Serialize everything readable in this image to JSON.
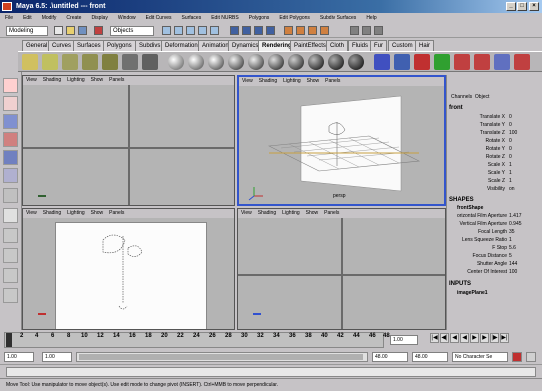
{
  "window": {
    "title": "Maya 6.5: .\\untitled   ---   front",
    "buttons": [
      "_",
      "□",
      "×"
    ]
  },
  "menus": [
    "File",
    "Edit",
    "Modify",
    "Create",
    "Display",
    "Window",
    "Edit Curves",
    "Surfaces",
    "Edit NURBS",
    "Polygons",
    "Edit Polygons",
    "Subdiv Surfaces",
    "Help"
  ],
  "status_line": {
    "mode": "Modeling",
    "selection_mask": "Objects"
  },
  "shelf_tabs": [
    "General",
    "Curves",
    "Surfaces",
    "Polygons",
    "Subdivs",
    "Deformation",
    "Animation",
    "Dynamics",
    "Rendering",
    "PaintEffects",
    "Cloth",
    "Fluids",
    "Fur",
    "Custom",
    "Hair"
  ],
  "active_shelf_tab": "Rendering",
  "viewport_menu": [
    "View",
    "Shading",
    "Lighting",
    "Show",
    "Panels"
  ],
  "viewports": {
    "top_right_label": "persp"
  },
  "channel_box": {
    "tabs": [
      "Channels",
      "Object"
    ],
    "object": "front",
    "transform": [
      {
        "name": "Translate X",
        "value": "0"
      },
      {
        "name": "Translate Y",
        "value": "0"
      },
      {
        "name": "Translate Z",
        "value": "100"
      },
      {
        "name": "Rotate X",
        "value": "0"
      },
      {
        "name": "Rotate Y",
        "value": "0"
      },
      {
        "name": "Rotate Z",
        "value": "0"
      },
      {
        "name": "Scale X",
        "value": "1"
      },
      {
        "name": "Scale Y",
        "value": "1"
      },
      {
        "name": "Scale Z",
        "value": "1"
      },
      {
        "name": "Visibility",
        "value": "on"
      }
    ],
    "shapes_header": "SHAPES",
    "shape_name": "frontShape",
    "shape_attrs": [
      {
        "name": "orizontal Film Aperture",
        "value": "1.417"
      },
      {
        "name": "Vertical Film Aperture",
        "value": "0.945"
      },
      {
        "name": "Focal Length",
        "value": "35"
      },
      {
        "name": "Lens Squeeze Ratio",
        "value": "1"
      },
      {
        "name": "F Stop",
        "value": "5.6"
      },
      {
        "name": "Focus Distance",
        "value": "5"
      },
      {
        "name": "Shutter Angle",
        "value": "144"
      },
      {
        "name": "Center Of Interest",
        "value": "100"
      }
    ],
    "inputs_header": "INPUTS",
    "input_name": "imagePlane1"
  },
  "timeline": {
    "ticks": [
      "2",
      "4",
      "6",
      "8",
      "10",
      "12",
      "14",
      "16",
      "18",
      "20",
      "22",
      "24",
      "26",
      "28",
      "30",
      "32",
      "34",
      "36",
      "38",
      "40",
      "42",
      "44",
      "46",
      "48"
    ],
    "current": "1.00"
  },
  "range": {
    "start": "1.00",
    "inner_start": "1.00",
    "inner_end": "48.00",
    "end": "48.00",
    "character": "No Character Se"
  },
  "help_line": "Move Tool: Use manipulator to move object(s). Use edit mode to change pivot (INSERT). Ctrl+MMB to move perpendicular."
}
